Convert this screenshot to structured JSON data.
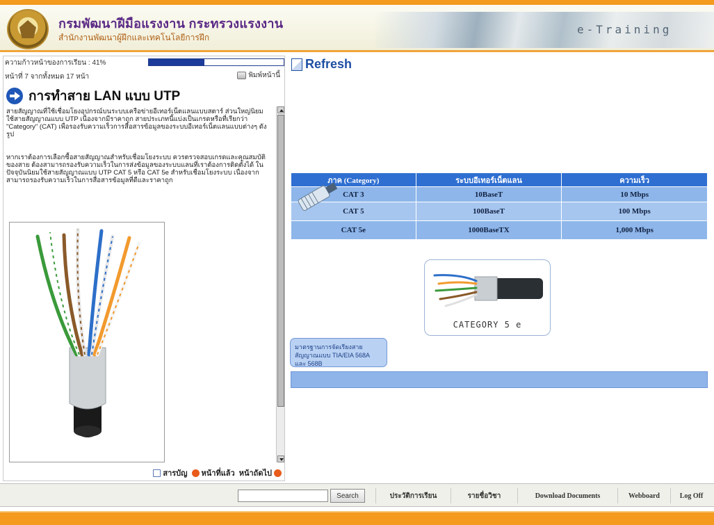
{
  "header": {
    "org_title": "กรมพัฒนาฝีมือแรงงาน กระทรวงแรงงาน",
    "org_subtitle": "สำนักงานพัฒนาผู้ฝึกและเทคโนโลยีการฝึก",
    "brand": "e-Training"
  },
  "left": {
    "progress_label": "ความก้าวหน้าของการเรียน : ",
    "progress_value": "41%",
    "progress_fraction": 0.41,
    "page_info": "หน้าที่ 7 จากทั้งหมด 17 หน้า",
    "print_label": "พิมพ์หน้านี้",
    "lesson_title": "การทำสาย LAN แบบ UTP",
    "paragraph_1": "สายสัญญาณที่ใช้เชื่อมโยงอุปกรณ์บนระบบเครือข่ายอีเทอร์เน็ตแลนแบบสตาร์ ส่วนใหญ่นิยมใช้สายสัญญาณแบบ UTP เนื่องจากมีราคาถูก สายประเภทนี้แบ่งเป็นเกรดหรือที่เรียกว่า \"Category\" (CAT) เพื่อรองรับความเร็วการสื่อสารข้อมูลของระบบอีเทอร์เน็ตแลนแบบต่างๆ ดังรูป",
    "paragraph_2": "หากเราต้องการเลือกซื้อสายสัญญาณสำหรับเชื่อมโยงระบบ ควรตรวจสอบเกรดและคุณสมบัติของสาย ต้องสามารถรองรับความเร็วในการส่งข้อมูลของระบบแลนที่เราต้องการติดตั้งได้ ในปัจจุบันนิยมใช้สายสัญญาณแบบ UTP CAT 5 หรือ CAT 5e สำหรับเชื่อมโยงระบบ เนื่องจากสามารถรองรับความเร็วในการสื่อสารข้อมูลที่ดีและราคาถูก",
    "nav": {
      "contents": "สารบัญ",
      "previous": "หน้าที่แล้ว",
      "next": "หน้าถัดไป"
    }
  },
  "right": {
    "refresh_label": "Refresh",
    "table": {
      "headers": [
        "ภาค (Category)",
        "ระบบอีเทอร์เน็ตแลน",
        "ความเร็ว"
      ],
      "rows": [
        [
          "CAT 3",
          "10BaseT",
          "10 Mbps"
        ],
        [
          "CAT 5",
          "100BaseT",
          "100 Mbps"
        ],
        [
          "CAT 5e",
          "1000BaseTX",
          "1,000 Mbps"
        ]
      ]
    },
    "image_caption": "CATEGORY 5 e",
    "standard_box": "มาตรฐานการจัดเรียงสายสัญญาณแบบ TIA/EIA 568A และ 568B"
  },
  "bottom": {
    "search_placeholder": "",
    "search_button": "Search",
    "links": [
      "ประวัติการเรียน",
      "รายชื่อวิชา",
      "Download Documents",
      "Webboard",
      "Log Off"
    ]
  },
  "colors": {
    "accent_orange": "#f39a1f",
    "table_header_blue": "#2f6fd1",
    "table_cell_blue": "#8eb6ea",
    "title_purple": "#5b2a86"
  }
}
